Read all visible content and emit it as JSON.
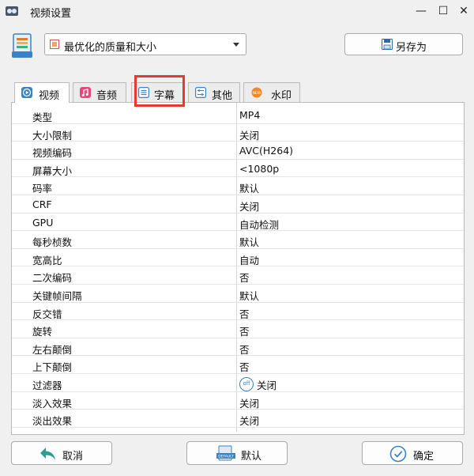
{
  "window": {
    "title": "视频设置"
  },
  "preset": {
    "selected": "最优化的质量和大小"
  },
  "toolbar": {
    "save_as_label": "另存为"
  },
  "tabs": [
    {
      "label": "视频",
      "icon": "play-circle-icon",
      "active": true
    },
    {
      "label": "音频",
      "icon": "music-note-icon",
      "active": false
    },
    {
      "label": "字幕",
      "icon": "subtitle-icon",
      "active": false,
      "highlighted": true
    },
    {
      "label": "其他",
      "icon": "sliders-icon",
      "active": false
    },
    {
      "label": "水印",
      "icon": "watermark-icon",
      "active": false
    }
  ],
  "settings": [
    {
      "key": "类型",
      "value": "MP4"
    },
    {
      "key": "大小限制",
      "value": "关闭"
    },
    {
      "key": "视频编码",
      "value": "AVC(H264)"
    },
    {
      "key": "屏幕大小",
      "value": "<1080p"
    },
    {
      "key": "码率",
      "value": "默认"
    },
    {
      "key": "CRF",
      "value": "关闭"
    },
    {
      "key": "GPU",
      "value": "自动检测"
    },
    {
      "key": "每秒桢数",
      "value": "默认"
    },
    {
      "key": "宽高比",
      "value": "自动"
    },
    {
      "key": "二次编码",
      "value": "否"
    },
    {
      "key": "关键帧间隔",
      "value": "默认"
    },
    {
      "key": "反交错",
      "value": "否"
    },
    {
      "key": "旋转",
      "value": "否"
    },
    {
      "key": "左右颠倒",
      "value": "否"
    },
    {
      "key": "上下颠倒",
      "value": "否"
    },
    {
      "key": "过滤器",
      "value": "关闭",
      "badge": "off"
    },
    {
      "key": "淡入效果",
      "value": "关闭"
    },
    {
      "key": "淡出效果",
      "value": "关闭"
    }
  ],
  "buttons": {
    "cancel": "取消",
    "default": "默认",
    "default_icon_text": "DEFAULT",
    "ok": "确定"
  },
  "colors": {
    "highlight": "#e53935",
    "accent": "#3b82c4",
    "cancel_arrow": "#2e9e8f"
  }
}
